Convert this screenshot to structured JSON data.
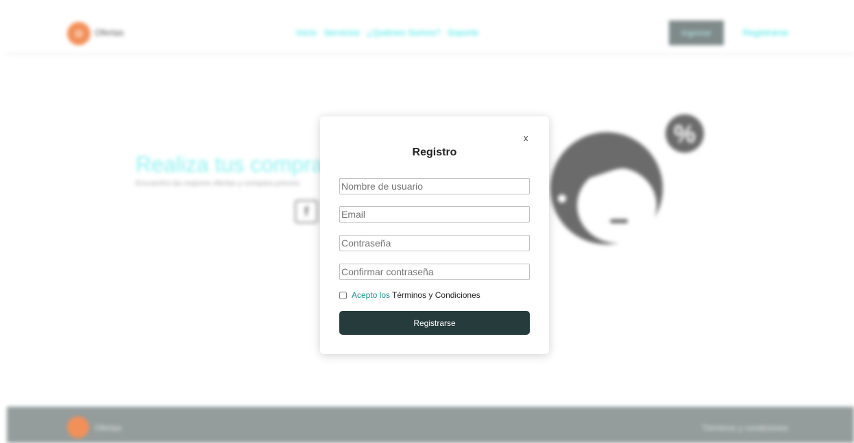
{
  "colors": {
    "brand": "#f2905a",
    "nav_link": "#3fe3e3",
    "primary_button": "#263b3b",
    "footer_bg": "#949c9c",
    "terms_link": "#1c8c8c"
  },
  "header": {
    "logo_initial": "O",
    "logo_text": "Ofertas",
    "nav": [
      "Inicio",
      "Servicios",
      "¿Quiénes Somos?",
      "Soporte"
    ],
    "login_label": "Ingresar",
    "register_label": "Registrarse"
  },
  "hero": {
    "title": "Realiza tus compras",
    "subtitle": "Encuentra las mejores ofertas y compara precios",
    "facebook_glyph": "f",
    "badge_symbol": "%"
  },
  "modal": {
    "close_label": "x",
    "title": "Registro",
    "fields": {
      "username_placeholder": "Nombre de usuario",
      "email_placeholder": "Email",
      "password_placeholder": "Contraseña",
      "confirm_placeholder": "Confirmar contraseña"
    },
    "terms": {
      "link_text": "Acepto los",
      "text": "Términos y Condiciones",
      "checked": false
    },
    "submit_label": "Registrarse"
  },
  "footer": {
    "logo_initial": "O",
    "logo_text": "Ofertas",
    "terms_label": "Términos y condiciones"
  },
  "icons": {
    "close": "close-icon",
    "facebook": "facebook-icon",
    "discount_badge": "percent-badge-icon",
    "character": "character-illustration-icon"
  }
}
